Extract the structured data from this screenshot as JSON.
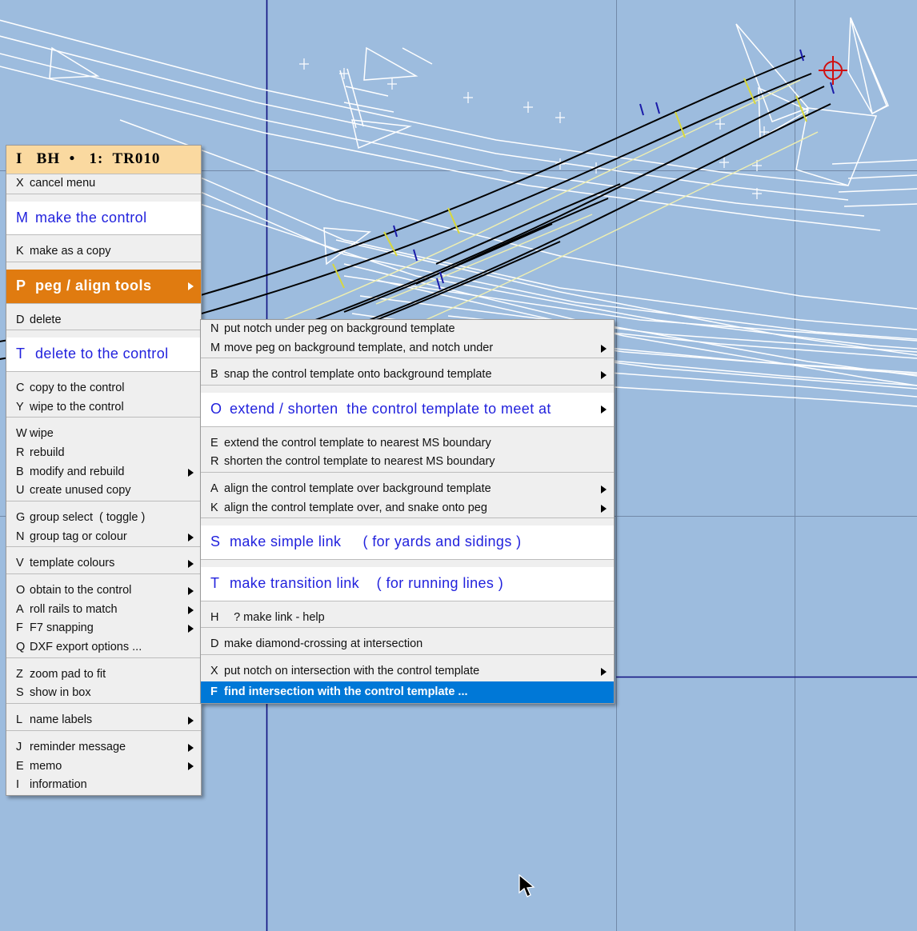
{
  "app": {
    "canvas_background": "#9dbcde",
    "grid_color": "#6f88a8",
    "axis_color": "#00008b",
    "control_template_color": "#000000",
    "background_template_color": "#ffffff",
    "mark_color": "#f2f2a0",
    "peg_color": "#d01010"
  },
  "main_menu": {
    "title": "I   BH  •   1:  TR010",
    "sections": [
      {
        "rows": [
          {
            "key": "X",
            "label": "cancel menu",
            "style": "normal",
            "arrow": false
          }
        ]
      },
      {
        "rows": [
          {
            "key": "M",
            "label": "make the control",
            "style": "hi",
            "arrow": false
          }
        ]
      },
      {
        "rows": [
          {
            "key": "K",
            "label": "make as a copy",
            "style": "normal",
            "arrow": false
          }
        ]
      },
      {
        "rows": [
          {
            "key": "P",
            "label": "peg / align tools",
            "style": "sel",
            "arrow": true
          }
        ]
      },
      {
        "rows": [
          {
            "key": "D",
            "label": "delete",
            "style": "normal",
            "arrow": false
          }
        ]
      },
      {
        "rows": [
          {
            "key": "T",
            "label": "delete to the control",
            "style": "hi",
            "arrow": false
          }
        ]
      },
      {
        "rows": [
          {
            "key": "C",
            "label": "copy to the control",
            "style": "normal",
            "arrow": false
          },
          {
            "key": "Y",
            "label": "wipe to the control",
            "style": "normal",
            "arrow": false
          }
        ]
      },
      {
        "rows": [
          {
            "key": "W",
            "label": "wipe",
            "style": "normal",
            "arrow": false
          },
          {
            "key": "R",
            "label": "rebuild",
            "style": "normal",
            "arrow": false
          },
          {
            "key": "B",
            "label": "modify and rebuild",
            "style": "normal",
            "arrow": true
          },
          {
            "key": "U",
            "label": "create unused copy",
            "style": "normal",
            "arrow": false
          }
        ]
      },
      {
        "rows": [
          {
            "key": "G",
            "label": "group select  ( toggle )",
            "style": "normal",
            "arrow": false
          },
          {
            "key": "N",
            "label": "group tag or colour",
            "style": "normal",
            "arrow": true
          }
        ]
      },
      {
        "rows": [
          {
            "key": "V",
            "label": "template colours",
            "style": "normal",
            "arrow": true
          }
        ]
      },
      {
        "rows": [
          {
            "key": "O",
            "label": "obtain to the control",
            "style": "normal",
            "arrow": true
          },
          {
            "key": "A",
            "label": "roll rails to match",
            "style": "normal",
            "arrow": true
          },
          {
            "key": "F",
            "label": "F7 snapping",
            "style": "normal",
            "arrow": true
          },
          {
            "key": "Q",
            "label": "DXF export options ...",
            "style": "normal",
            "arrow": false
          }
        ]
      },
      {
        "rows": [
          {
            "key": "Z",
            "label": "zoom pad to fit",
            "style": "normal",
            "arrow": false
          },
          {
            "key": "S",
            "label": "show in box",
            "style": "normal",
            "arrow": false
          }
        ]
      },
      {
        "rows": [
          {
            "key": "L",
            "label": "name labels",
            "style": "normal",
            "arrow": true
          }
        ]
      },
      {
        "rows": [
          {
            "key": "J",
            "label": "reminder message",
            "style": "normal",
            "arrow": true
          },
          {
            "key": "E",
            "label": "memo",
            "style": "normal",
            "arrow": true
          },
          {
            "key": "I",
            "label": "information",
            "style": "normal",
            "arrow": false
          }
        ]
      }
    ]
  },
  "sub_menu": {
    "sections": [
      {
        "rows": [
          {
            "key": "N",
            "label": "put notch under peg on background template",
            "style": "normal",
            "arrow": false
          },
          {
            "key": "M",
            "label": "move peg on background template, and notch under",
            "style": "normal",
            "arrow": true
          }
        ]
      },
      {
        "rows": [
          {
            "key": "B",
            "label": "snap the control template onto background template",
            "style": "normal",
            "arrow": true
          }
        ]
      },
      {
        "rows": [
          {
            "key": "O",
            "label": "extend / shorten  the control template to meet at",
            "style": "hi",
            "arrow": true
          }
        ]
      },
      {
        "rows": [
          {
            "key": "E",
            "label": "extend the control template to nearest MS boundary",
            "style": "normal",
            "arrow": false
          },
          {
            "key": "R",
            "label": "shorten the control template to nearest MS boundary",
            "style": "normal",
            "arrow": false
          }
        ]
      },
      {
        "rows": [
          {
            "key": "A",
            "label": "align the control template over background template",
            "style": "normal",
            "arrow": true
          },
          {
            "key": "K",
            "label": "align the control template over, and snake onto peg",
            "style": "normal",
            "arrow": true
          }
        ]
      },
      {
        "rows": [
          {
            "key": "S",
            "label": "make simple link     ( for yards and sidings )",
            "style": "hi",
            "arrow": false
          }
        ]
      },
      {
        "rows": [
          {
            "key": "T",
            "label": "make transition link    ( for running lines )",
            "style": "hi",
            "arrow": false
          }
        ]
      },
      {
        "rows": [
          {
            "key": "H",
            "label": "   ? make link - help",
            "style": "normal",
            "arrow": false
          }
        ]
      },
      {
        "rows": [
          {
            "key": "D",
            "label": "make diamond-crossing at intersection",
            "style": "normal",
            "arrow": false
          }
        ]
      },
      {
        "rows": [
          {
            "key": "X",
            "label": "put notch on intersection with the control template",
            "style": "normal",
            "arrow": true
          },
          {
            "key": "F",
            "label": "find intersection with the control template ...",
            "style": "selblue",
            "arrow": false
          }
        ]
      }
    ]
  }
}
